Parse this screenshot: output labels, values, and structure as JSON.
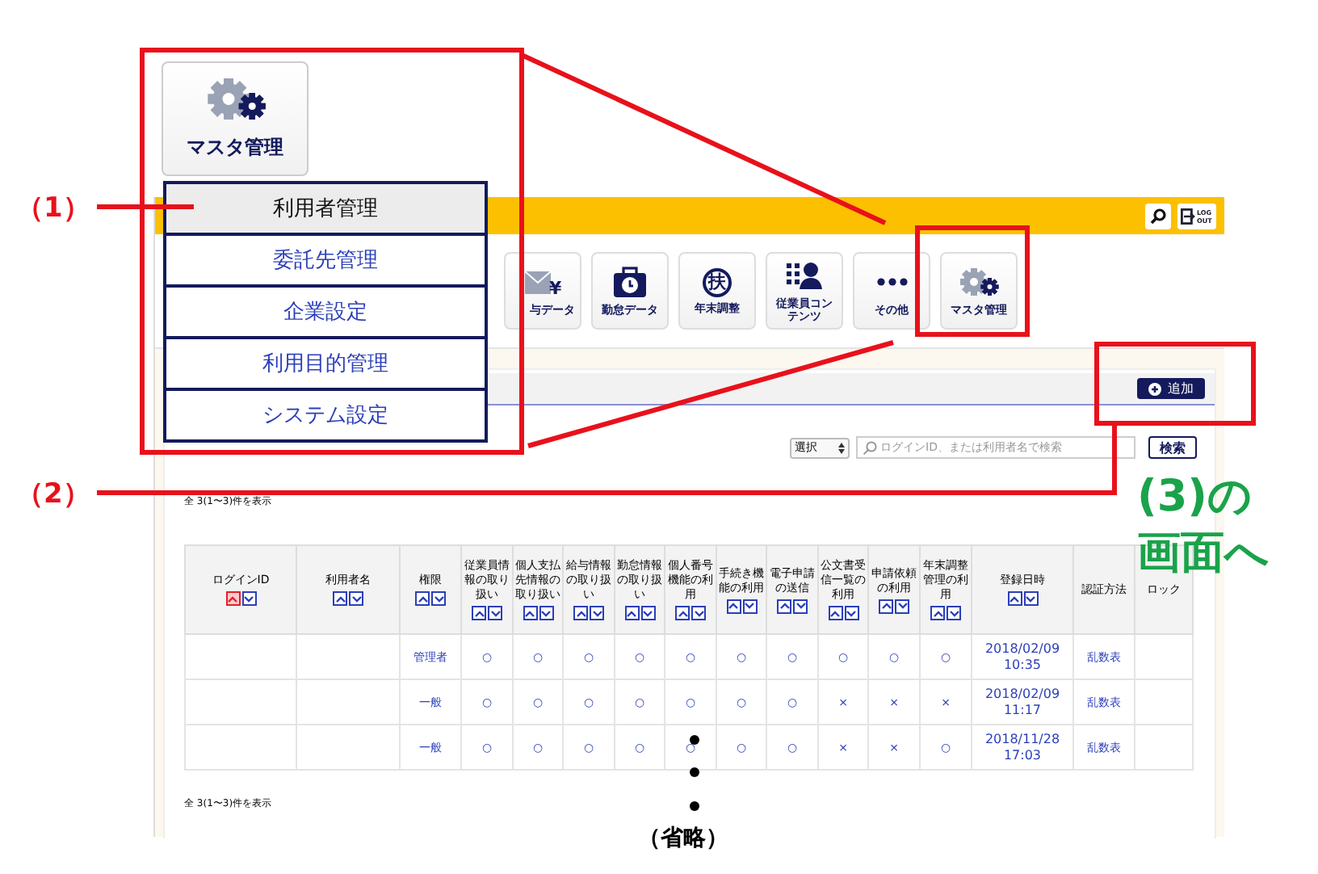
{
  "menu_button": {
    "label": "マスタ管理"
  },
  "dropdown": [
    {
      "label": "利用者管理",
      "selected": true
    },
    {
      "label": "委託先管理",
      "selected": false
    },
    {
      "label": "企業設定",
      "selected": false
    },
    {
      "label": "利用目的管理",
      "selected": false
    },
    {
      "label": "システム設定",
      "selected": false
    }
  ],
  "header": {
    "logout_label": "LOG OUT"
  },
  "toolbar": [
    {
      "kind": "payroll",
      "label": "与データ",
      "glyph": "¥"
    },
    {
      "kind": "attendance",
      "label": "勤怠データ"
    },
    {
      "kind": "yearend",
      "label": "年末調整",
      "glyph": "扶"
    },
    {
      "kind": "employee",
      "label": "従業員コンテンツ"
    },
    {
      "kind": "more",
      "label": "その他"
    },
    {
      "kind": "master",
      "label": "マスタ管理"
    }
  ],
  "panel": {
    "add_button": "追加"
  },
  "search": {
    "select": "選択",
    "placeholder": "ログインID、または利用者名で検索",
    "button": "検索"
  },
  "count_top": "全 3(1〜3)件を表示",
  "table": {
    "columns": [
      {
        "label": "ログインID",
        "sortable": true,
        "sorted_asc": true
      },
      {
        "label": "利用者名",
        "sortable": true,
        "sorted_asc": false
      },
      {
        "label": "権限",
        "sortable": true,
        "sorted_asc": false
      },
      {
        "label": "従業員情報の取り扱い",
        "sortable": true,
        "sorted_asc": false
      },
      {
        "label": "個人支払先情報の取り扱い",
        "sortable": true,
        "sorted_asc": false
      },
      {
        "label": "給与情報の取り扱い",
        "sortable": true,
        "sorted_asc": false
      },
      {
        "label": "勤怠情報の取り扱い",
        "sortable": true,
        "sorted_asc": false
      },
      {
        "label": "個人番号機能の利用",
        "sortable": true,
        "sorted_asc": false
      },
      {
        "label": "手続き機能の利用",
        "sortable": true,
        "sorted_asc": false
      },
      {
        "label": "電子申請の送信",
        "sortable": true,
        "sorted_asc": false
      },
      {
        "label": "公文書受信一覧の利用",
        "sortable": true,
        "sorted_asc": false
      },
      {
        "label": "申請依頼の利用",
        "sortable": true,
        "sorted_asc": false
      },
      {
        "label": "年末調整管理の利用",
        "sortable": true,
        "sorted_asc": false
      },
      {
        "label": "登録日時",
        "sortable": true,
        "sorted_asc": false
      },
      {
        "label": "認証方法",
        "sortable": false
      },
      {
        "label": "ロック",
        "sortable": false
      }
    ],
    "rows": [
      {
        "cells": [
          "",
          "",
          "管理者",
          "○",
          "○",
          "○",
          "○",
          "○",
          "○",
          "○",
          "○",
          "○",
          "○",
          "2018/02/09\n10:35",
          "乱数表",
          ""
        ]
      },
      {
        "cells": [
          "",
          "",
          "一般",
          "○",
          "○",
          "○",
          "○",
          "○",
          "○",
          "○",
          "×",
          "×",
          "×",
          "2018/02/09\n11:17",
          "乱数表",
          ""
        ]
      },
      {
        "cells": [
          "",
          "",
          "一般",
          "○",
          "○",
          "○",
          "○",
          "○",
          "○",
          "○",
          "×",
          "×",
          "○",
          "2018/11/28\n17:03",
          "乱数表",
          ""
        ]
      }
    ]
  },
  "count_bottom": "全 3(1〜3)件を表示",
  "annotations": {
    "label_1": "（1）",
    "label_2": "（2）",
    "note_3_line1": "(3)の",
    "note_3_line2": "画面へ",
    "omitted": "（省略）"
  }
}
